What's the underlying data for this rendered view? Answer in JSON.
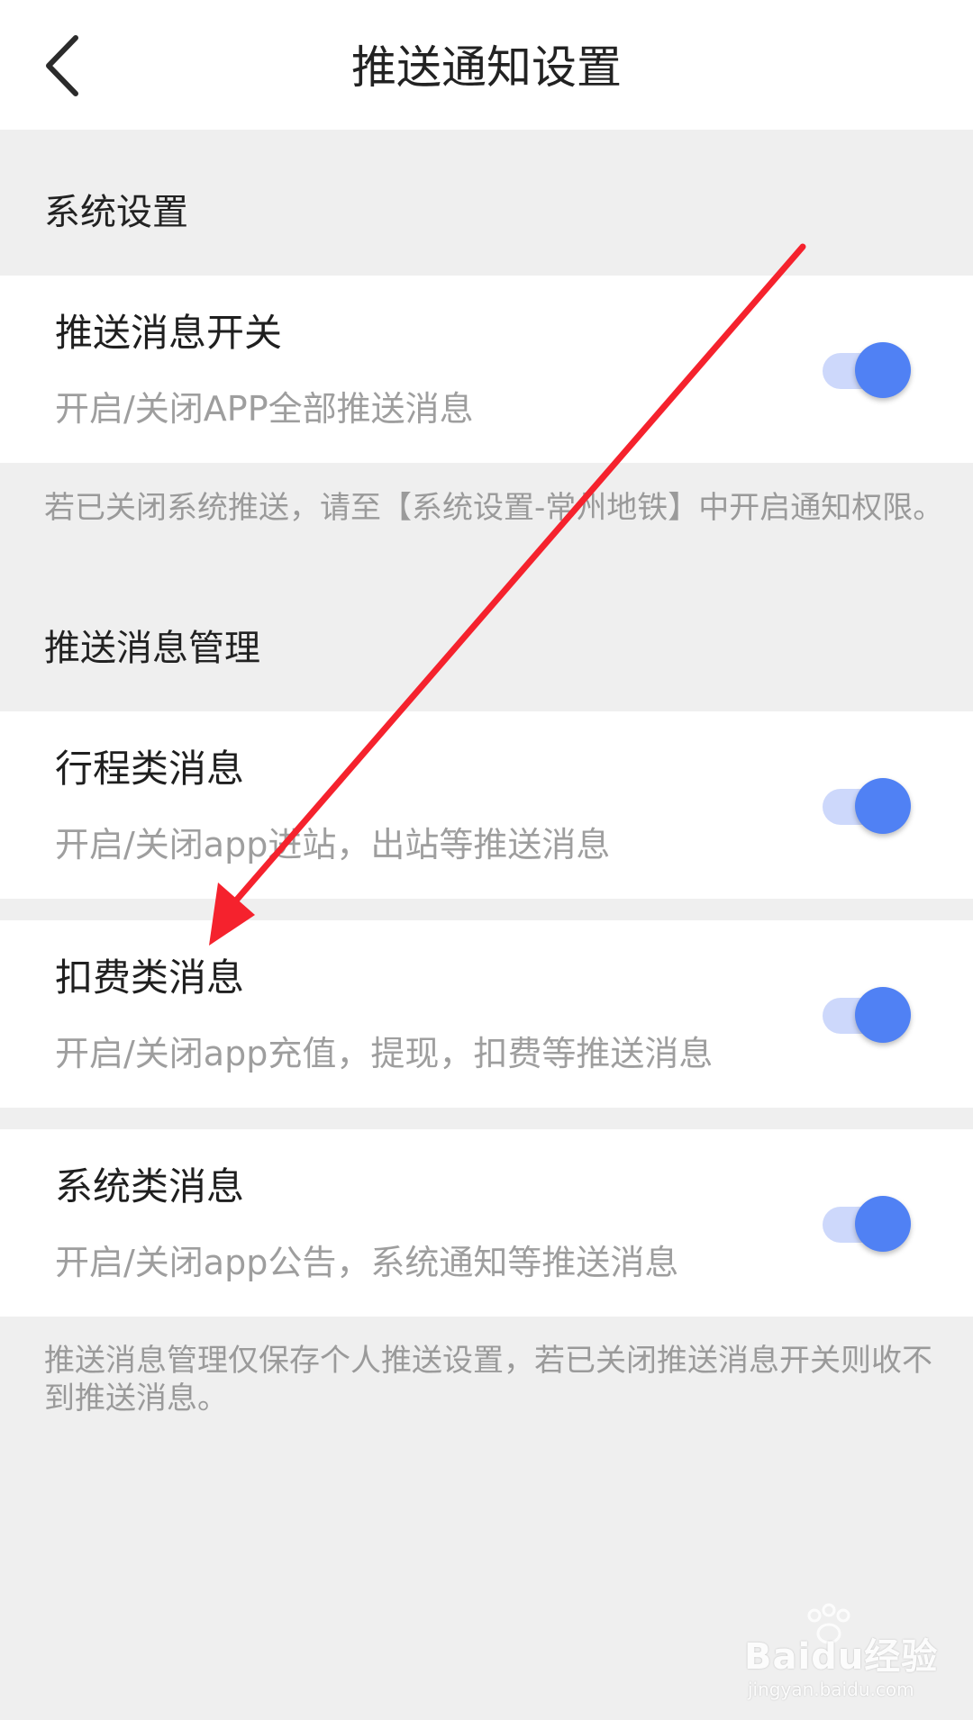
{
  "header": {
    "title": "推送通知设置",
    "back_icon": "chevron-left-icon"
  },
  "sections": [
    {
      "header": "系统设置",
      "items": [
        {
          "title": "推送消息开关",
          "subtitle": "开启/关闭APP全部推送消息",
          "enabled": true
        }
      ],
      "note": "若已关闭系统推送，请至【系统设置-常州地铁】中开启通知权限。"
    },
    {
      "header": "推送消息管理",
      "items": [
        {
          "title": "行程类消息",
          "subtitle": "开启/关闭app进站，出站等推送消息",
          "enabled": true
        },
        {
          "title": "扣费类消息",
          "subtitle": "开启/关闭app充值，提现，扣费等推送消息",
          "enabled": true
        },
        {
          "title": "系统类消息",
          "subtitle": "开启/关闭app公告，系统通知等推送消息",
          "enabled": true
        }
      ],
      "note": "推送消息管理仅保存个人推送设置，若已关闭推送消息开关则收不到推送消息。"
    }
  ],
  "watermark": {
    "logo_text": "Baidu经验",
    "url": "jingyan.baidu.com"
  },
  "colors": {
    "toggle_on_knob": "#5081f4",
    "toggle_on_track": "#cdd8fb",
    "annotation_arrow": "#f5222d",
    "page_background": "#efefef"
  }
}
